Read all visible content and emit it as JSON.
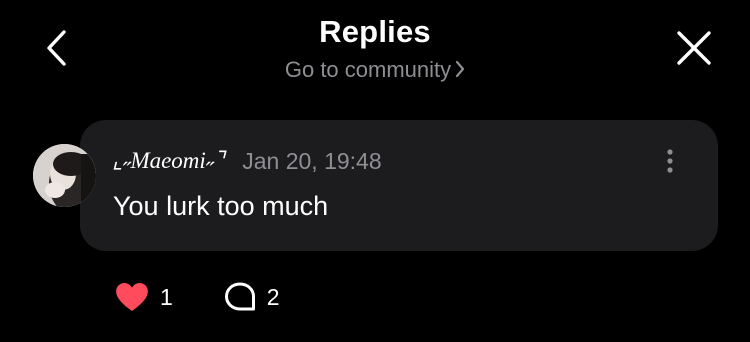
{
  "header": {
    "title": "Replies",
    "subtitle": "Go to community",
    "back_icon": "chevron-left-icon",
    "close_icon": "close-icon"
  },
  "reply": {
    "username": "ˆ˛Maeomi˛˛",
    "username_display": "⌞˶Maeomi˶⌝",
    "timestamp": "Jan 20, 19:48",
    "text": "You lurk too much",
    "more_icon": "more-vertical-icon",
    "avatar_icon": "avatar"
  },
  "actions": {
    "like_count": "1",
    "reply_count": "2",
    "like_icon": "heart-icon",
    "reply_icon": "comment-icon"
  },
  "colors": {
    "background": "#000000",
    "bubble": "#1c1c1e",
    "muted_text": "#8e8e93",
    "heart": "#ff4b5c",
    "text": "#ffffff"
  }
}
